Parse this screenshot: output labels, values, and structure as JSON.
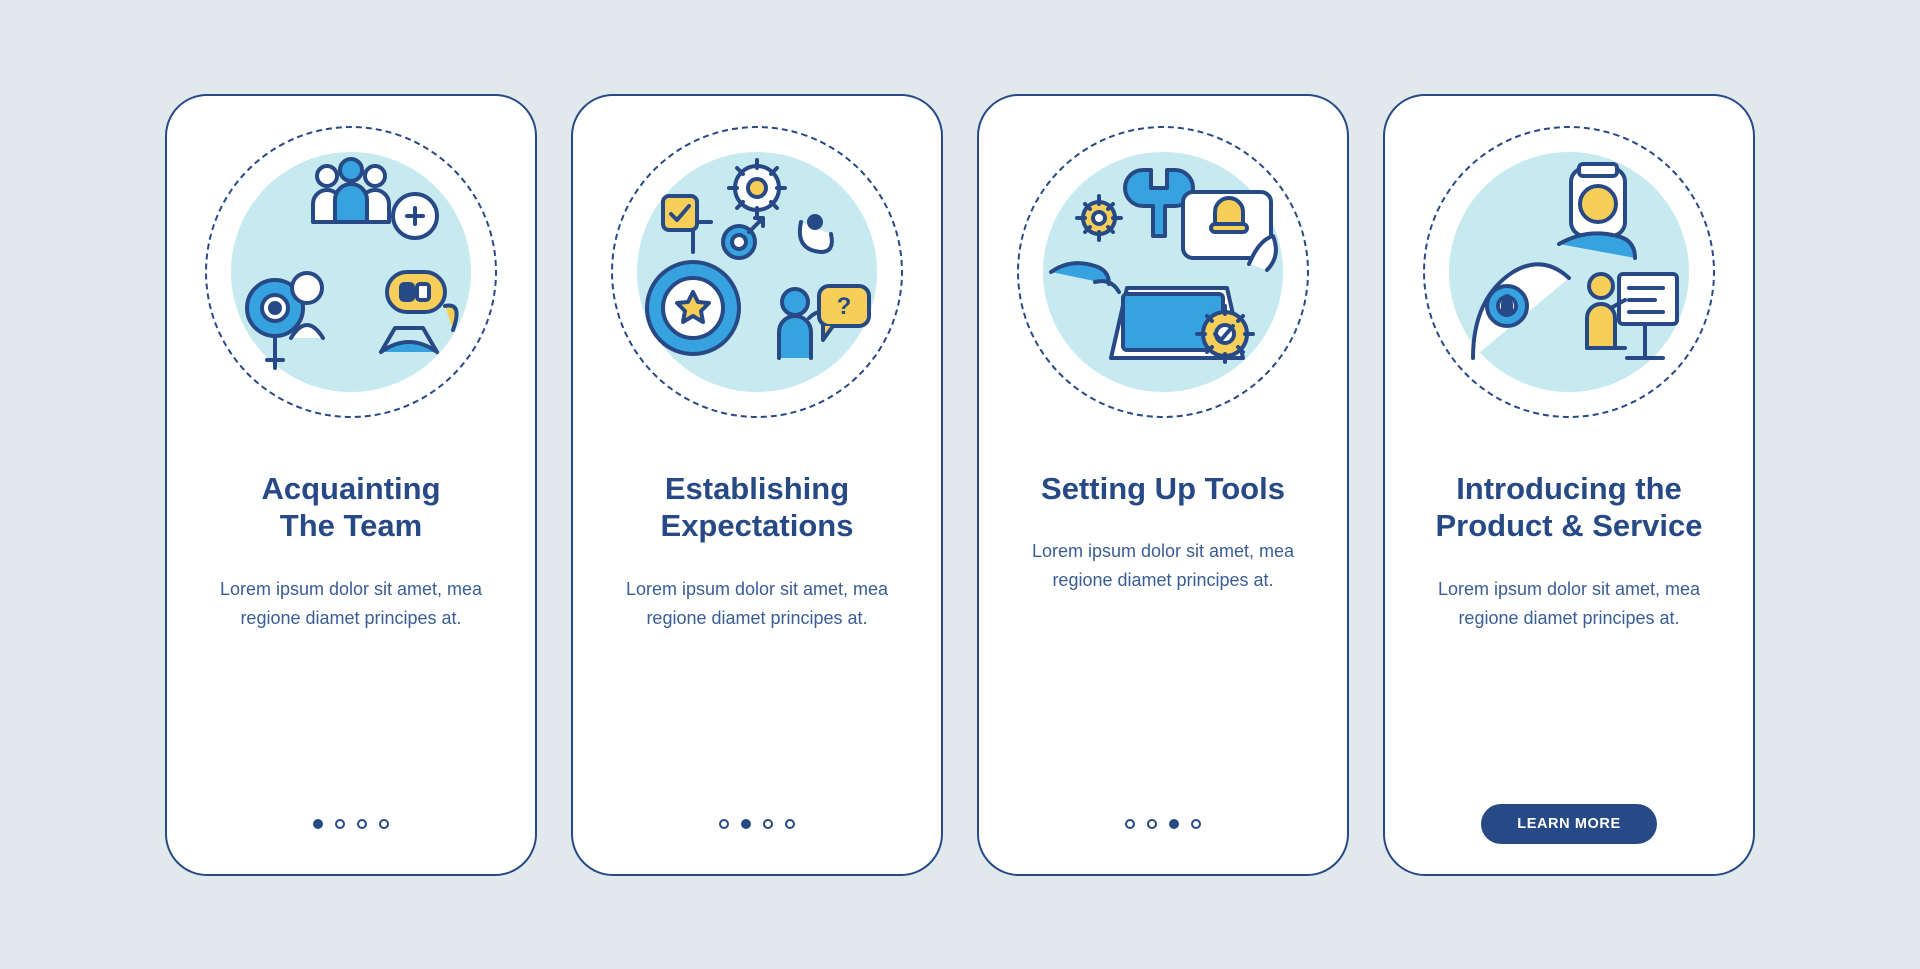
{
  "colors": {
    "stroke": "#274a87",
    "blue": "#36a3e0",
    "yellow": "#f7cf58",
    "bg_circle": "#c7eaf0"
  },
  "screens": [
    {
      "title": "Acquainting\nThe Team",
      "description": "Lorem ipsum dolor sit amet, mea regione diamet principes at.",
      "active_dot": 0,
      "footer": "dots",
      "icon": "team-icon"
    },
    {
      "title": "Establishing\nExpectations",
      "description": "Lorem ipsum dolor sit amet, mea regione diamet principes at.",
      "active_dot": 1,
      "footer": "dots",
      "icon": "expectations-icon"
    },
    {
      "title": "Setting Up Tools",
      "description": "Lorem ipsum dolor sit amet, mea regione diamet principes at.",
      "active_dot": 2,
      "footer": "dots",
      "icon": "tools-icon"
    },
    {
      "title": "Introducing the\nProduct & Service",
      "description": "Lorem ipsum dolor sit amet, mea regione diamet principes at.",
      "active_dot": 3,
      "footer": "button",
      "button_label": "LEARN MORE",
      "icon": "product-icon"
    }
  ]
}
